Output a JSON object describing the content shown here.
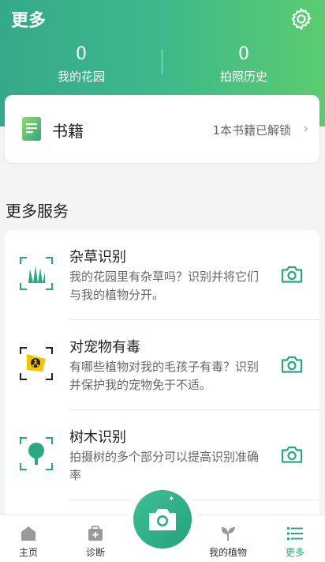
{
  "header": {
    "title": "更多",
    "stats": [
      {
        "value": "0",
        "label": "我的花园"
      },
      {
        "value": "0",
        "label": "拍照历史"
      }
    ]
  },
  "books": {
    "title": "书籍",
    "status": "1本书籍已解锁"
  },
  "services": {
    "section_title": "更多服务",
    "items": [
      {
        "name": "杂草识别",
        "desc": "我的花园里有杂草吗？识别并将它们与我的植物分开。",
        "icon": "weed-icon"
      },
      {
        "name": "对宠物有毒",
        "desc": "有哪些植物对我的毛孩子有毒？识别并保护我的宠物免于不适。",
        "icon": "pet-toxic-icon"
      },
      {
        "name": "树木识别",
        "desc": "拍摄树的多个部分可以提高识别准确率",
        "icon": "tree-icon"
      }
    ]
  },
  "tabbar": {
    "tabs": [
      {
        "label": "主页",
        "icon": "home-icon"
      },
      {
        "label": "诊断",
        "icon": "diagnose-icon"
      },
      {
        "label": "我的植物",
        "icon": "sprout-icon"
      },
      {
        "label": "更多",
        "icon": "list-icon",
        "active": true
      }
    ]
  },
  "colors": {
    "accent": "#2aa882",
    "active_tab": "#2aa882"
  }
}
